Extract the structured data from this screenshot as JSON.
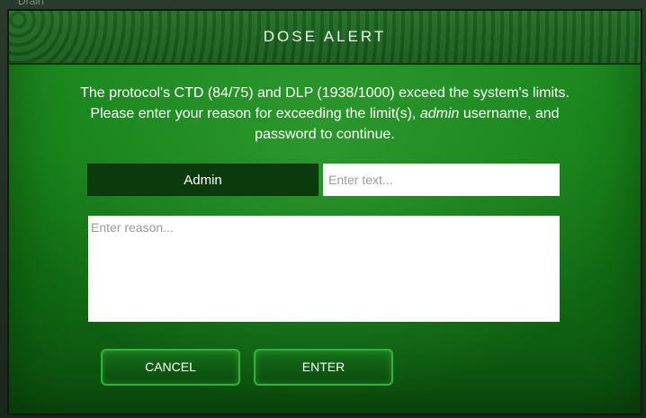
{
  "background": {
    "partial_label": "Drain"
  },
  "dialog": {
    "title": "DOSE ALERT",
    "message": {
      "part1": "The protocol's CTD (84/75) and DLP (1938/1000) exceed the system's limits. Please enter your reason for exceeding the limit(s), ",
      "emphasis": "admin",
      "part2": " username, and password to continue."
    },
    "user_label": "Admin",
    "password_placeholder": "Enter text...",
    "reason_placeholder": "Enter reason...",
    "cancel_label": "CANCEL",
    "enter_label": "ENTER"
  },
  "colors": {
    "dialog_green": "#178019",
    "title_bar": "#15561a",
    "button_border": "#2fb43a",
    "label_dark": "#0b3a0d"
  }
}
